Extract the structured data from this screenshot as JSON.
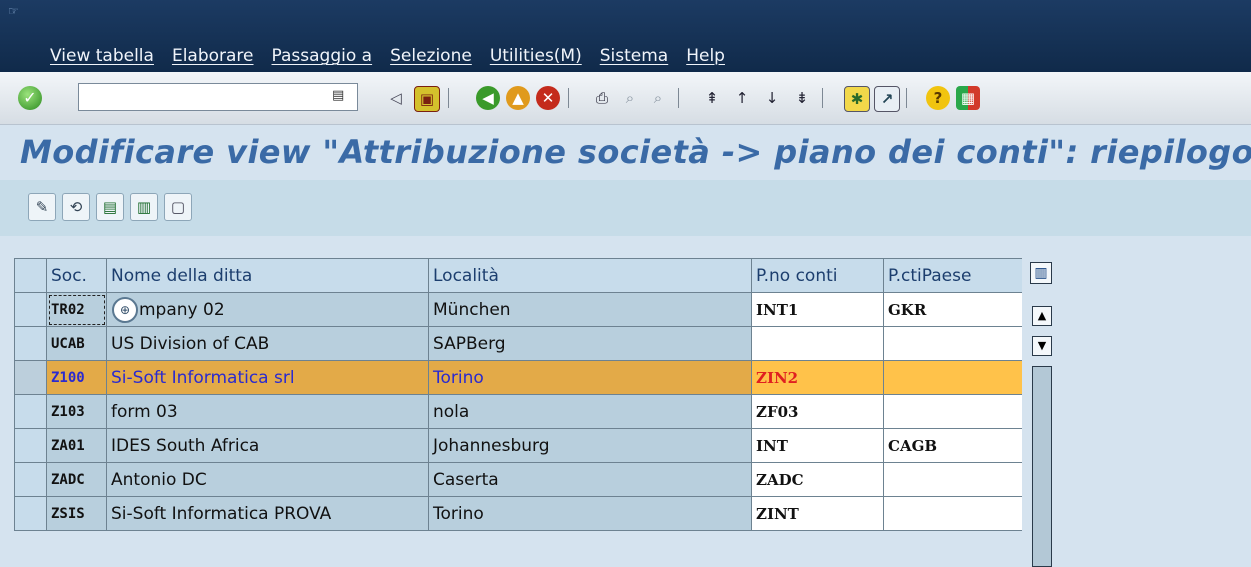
{
  "menu": [
    "View tabella",
    "Elaborare",
    "Passaggio a",
    "Selezione",
    "Utilities(M)",
    "Sistema",
    "Help"
  ],
  "toolbar": {
    "command_value": "",
    "icons": [
      "enter-icon",
      "command-history-icon",
      "back-arrow-icon",
      "save-icon",
      "back-icon",
      "exit-icon",
      "cancel-icon",
      "print-icon",
      "find-icon",
      "find-next-icon",
      "first-page-icon",
      "previous-page-icon",
      "next-page-icon",
      "last-page-icon",
      "create-session-icon",
      "shortcut-icon",
      "help-icon",
      "customize-layout-icon"
    ]
  },
  "title": "Modificare view \"Attribuzione società -> piano dei conti\": riepilogo",
  "app_toolbar": [
    "change-display-icon",
    "toggle-edit-icon",
    "select-all-icon",
    "select-block-icon",
    "deselect-all-icon"
  ],
  "table": {
    "headers": [
      "Soc.",
      "Nome della ditta",
      "Località",
      "P.no conti",
      "P.ctiPaese"
    ],
    "rows": [
      {
        "soc": "TR02",
        "name": "mpany 02",
        "loc": "München",
        "pno": "INT1",
        "pcti": "GKR"
      },
      {
        "soc": "UCAB",
        "name": "US Division of CAB",
        "loc": "SAPBerg",
        "pno": "",
        "pcti": ""
      },
      {
        "soc": "Z100",
        "name": "Si-Soft Informatica srl",
        "loc": "Torino",
        "pno": "ZIN2",
        "pcti": ""
      },
      {
        "soc": "Z103",
        "name": "form 03",
        "loc": "nola",
        "pno": "ZF03",
        "pcti": ""
      },
      {
        "soc": "ZA01",
        "name": "IDES South Africa",
        "loc": "Johannesburg",
        "pno": "INT",
        "pcti": "CAGB"
      },
      {
        "soc": "ZADC",
        "name": "Antonio DC",
        "loc": "Caserta",
        "pno": "ZADC",
        "pcti": ""
      },
      {
        "soc": "ZSIS",
        "name": "Si-Soft Informatica PROVA",
        "loc": "Torino",
        "pno": "ZINT",
        "pcti": ""
      }
    ],
    "highlighted_row": 2
  },
  "colors": {
    "title": "#3a6aa6",
    "highlight_row": "#e3aa48",
    "highlight_input": "#ffc24a"
  }
}
